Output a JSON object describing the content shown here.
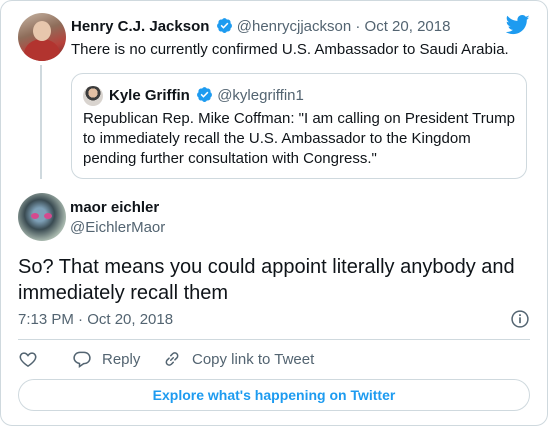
{
  "parent_tweet": {
    "name": "Henry C.J. Jackson",
    "handle": "@henrycjjackson",
    "separator": "·",
    "date": "Oct 20, 2018",
    "text": "There is no currently confirmed U.S. Ambassador to Saudi Arabia."
  },
  "quoted_tweet": {
    "name": "Kyle Griffin",
    "handle": "@kylegriffin1",
    "text": "Republican Rep. Mike Coffman: \"I am calling on President Trump to immediately recall the U.S. Ambassador to the Kingdom pending further consultation with Congress.\""
  },
  "main_tweet": {
    "name": "maor eichler",
    "handle": "@EichlerMaor",
    "text": "So? That means you could appoint literally anybody and immediately recall them",
    "time": "7:13 PM · Oct 20, 2018"
  },
  "actions": {
    "reply_label": "Reply",
    "copy_link_label": "Copy link to Tweet"
  },
  "explore_label": "Explore what's happening on Twitter",
  "colors": {
    "twitter_blue": "#1d9bf0",
    "text_primary": "#0f1419",
    "text_secondary": "#536471",
    "border": "#cfd9de"
  },
  "icons": [
    "twitter-bird-icon",
    "verified-badge-icon",
    "info-icon",
    "heart-icon",
    "reply-icon",
    "link-icon"
  ]
}
